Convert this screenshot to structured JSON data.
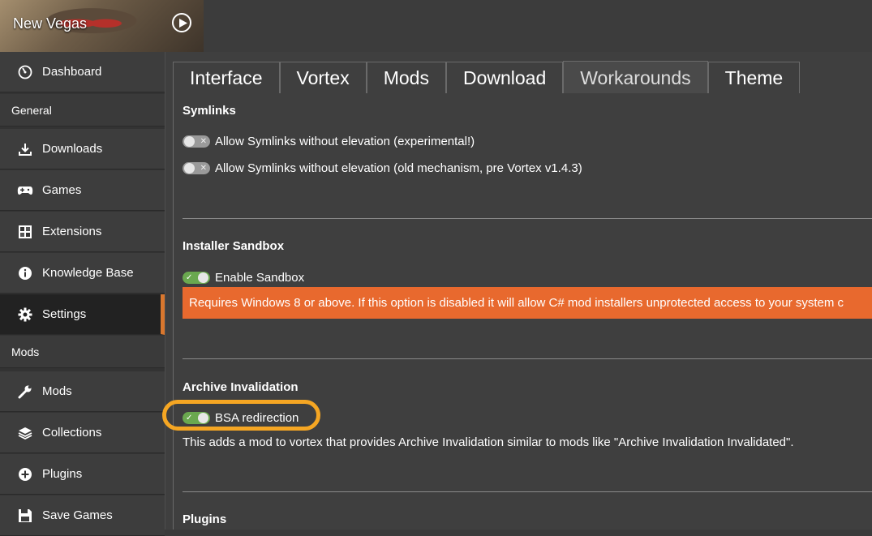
{
  "header": {
    "game_title": "New Vegas"
  },
  "sidebar": {
    "dashboard": "Dashboard",
    "general_heading": "General",
    "downloads": "Downloads",
    "games": "Games",
    "extensions": "Extensions",
    "knowledge_base": "Knowledge Base",
    "settings": "Settings",
    "mods_heading": "Mods",
    "mods": "Mods",
    "collections": "Collections",
    "plugins": "Plugins",
    "save_games": "Save Games"
  },
  "tabs": [
    "Interface",
    "Vortex",
    "Mods",
    "Download",
    "Workarounds",
    "Theme"
  ],
  "active_tab": "Workarounds",
  "sections": {
    "symlinks": {
      "title": "Symlinks",
      "opt1": "Allow Symlinks without elevation (experimental!)",
      "opt2": "Allow Symlinks without elevation (old mechanism, pre Vortex v1.4.3)"
    },
    "sandbox": {
      "title": "Installer Sandbox",
      "opt1": "Enable Sandbox",
      "warning": "Requires Windows 8 or above. If this option is disabled it will allow C# mod installers unprotected access to your system c"
    },
    "archive": {
      "title": "Archive Invalidation",
      "opt1": "BSA redirection",
      "description": "This adds a mod to vortex that provides Archive Invalidation similar to mods like \"Archive Invalidation Invalidated\"."
    },
    "plugins": {
      "title": "Plugins"
    }
  },
  "toggles": {
    "symlinks_experimental": false,
    "symlinks_old": false,
    "sandbox": true,
    "bsa_redirection": true
  },
  "colors": {
    "accent": "#d9772e",
    "warning_bg": "#e8692e",
    "toggle_on": "#6aa84f",
    "highlight": "#f5a623"
  }
}
